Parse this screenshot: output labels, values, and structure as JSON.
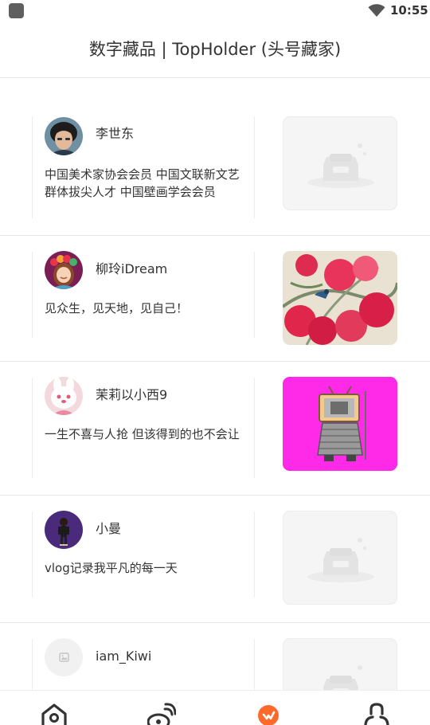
{
  "status_bar": {
    "time": "10:55",
    "wifi_icon": "wifi-icon",
    "app_icon": "app-notification-icon"
  },
  "header": {
    "title": "数字藏品 | TopHolder (头号藏家)"
  },
  "holders": [
    {
      "name": "李世东",
      "bio": "中国美术家协会会员 中国文联新文艺群体拔尖人才 中国壁画学会会员",
      "avatar": "avatar-photo-man",
      "artwork": "image-placeholder-icon"
    },
    {
      "name": "柳玲iDream",
      "bio": "见众生，见天地，见自己！",
      "avatar": "avatar-girl-flower-crown",
      "artwork": "flower-bird-painting"
    },
    {
      "name": "茉莉以小西9",
      "bio": "一生不喜与人抢 但该得到的也不会让",
      "avatar": "avatar-bunny-hat",
      "artwork": "robot-warrior-magenta"
    },
    {
      "name": "小曼",
      "bio": "vlog记录我平凡的每一天",
      "avatar": "avatar-figure-purple",
      "artwork": "image-placeholder-icon"
    },
    {
      "name": "iam_Kiwi",
      "bio": "",
      "avatar": "image-placeholder-icon",
      "artwork": "image-placeholder-icon"
    }
  ],
  "tabbar": {
    "items": [
      {
        "icon": "home-icon",
        "active": false
      },
      {
        "icon": "weibo-icon",
        "active": false
      },
      {
        "icon": "brand-orange-icon",
        "active": true
      },
      {
        "icon": "profile-icon",
        "active": false
      }
    ]
  },
  "colors": {
    "accent": "#ff6a2a",
    "magenta": "#ff2ae8",
    "divider": "#e6e6e6"
  }
}
